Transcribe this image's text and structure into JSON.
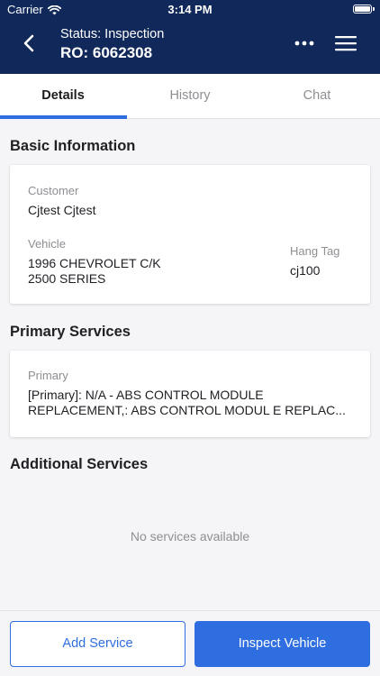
{
  "status_bar": {
    "carrier": "Carrier",
    "time": "3:14 PM"
  },
  "header": {
    "status": "Status: Inspection",
    "ro_number": "RO: 6062308"
  },
  "tabs": [
    {
      "label": "Details",
      "active": true
    },
    {
      "label": "History",
      "active": false
    },
    {
      "label": "Chat",
      "active": false
    }
  ],
  "basic_info": {
    "section_title": "Basic Information",
    "customer_label": "Customer",
    "customer_value": "Cjtest Cjtest",
    "vehicle_label": "Vehicle",
    "vehicle_line1": "1996 CHEVROLET C/K",
    "vehicle_line2": "2500 SERIES",
    "hang_tag_label": "Hang Tag",
    "hang_tag_value": "cj100"
  },
  "primary_services": {
    "section_title": "Primary Services",
    "label": "Primary",
    "line1": "[Primary]: N/A - ABS CONTROL MODULE",
    "line2": "REPLACEMENT,: ABS CONTROL MODUL E REPLAC..."
  },
  "additional_services": {
    "section_title": "Additional Services",
    "empty_text": "No services available"
  },
  "footer": {
    "add_service_label": "Add Service",
    "inspect_vehicle_label": "Inspect Vehicle"
  },
  "colors": {
    "header_bg": "#11295a",
    "accent": "#2f6ee0",
    "background": "#f5f5f7",
    "muted_text": "#8e8e93"
  },
  "icons": {
    "back": "chevron-left-icon",
    "more": "more-horizontal-icon",
    "menu": "hamburger-menu-icon",
    "wifi": "wifi-icon",
    "battery": "battery-icon"
  }
}
